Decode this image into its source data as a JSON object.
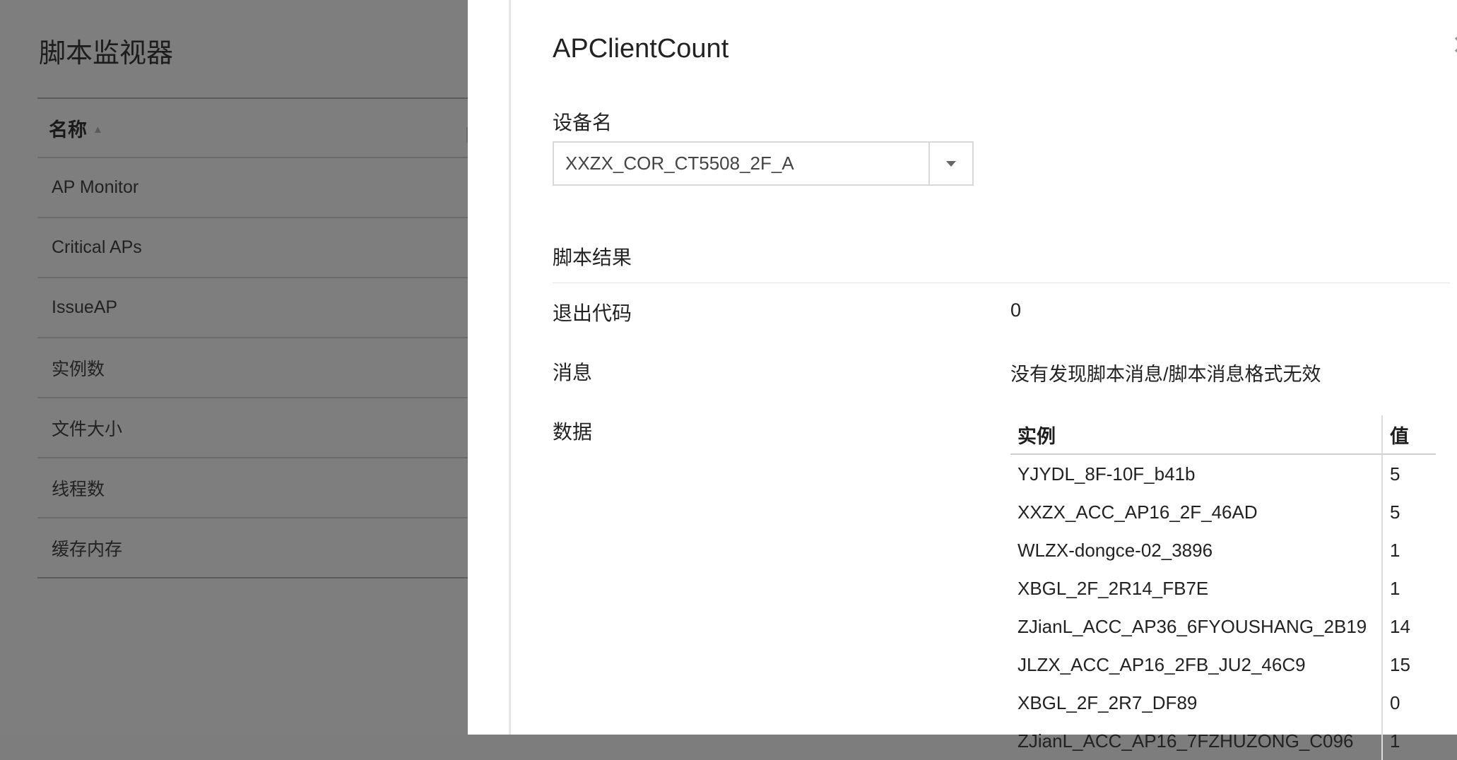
{
  "left": {
    "title": "脚本监视器",
    "column_header": "名称",
    "sort_icon": "▲",
    "rows": [
      "AP Monitor",
      "Critical APs",
      "IssueAP",
      "实例数",
      "文件大小",
      "线程数",
      "缓存内存"
    ]
  },
  "panel": {
    "title": "APClientCount",
    "close_icon": "✕",
    "device_label": "设备名",
    "device_value": "XXZX_COR_CT5508_2F_A",
    "result_section": "脚本结果",
    "exit_code_label": "退出代码",
    "exit_code_value": "0",
    "message_label": "消息",
    "message_value": "没有发现脚本消息/脚本消息格式无效",
    "data_label": "数据",
    "table": {
      "headers": [
        "实例",
        "值"
      ],
      "rows": [
        [
          "YJYDL_8F-10F_b41b",
          "5"
        ],
        [
          "XXZX_ACC_AP16_2F_46AD",
          "5"
        ],
        [
          "WLZX-dongce-02_3896",
          "1"
        ],
        [
          "XBGL_2F_2R14_FB7E",
          "1"
        ],
        [
          "ZJianL_ACC_AP36_6FYOUSHANG_2B19",
          "14"
        ],
        [
          "JLZX_ACC_AP16_2FB_JU2_46C9",
          "15"
        ],
        [
          "XBGL_2F_2R7_DF89",
          "0"
        ],
        [
          "ZJianL_ACC_AP16_7FZHUZONG_C096",
          "1"
        ]
      ]
    }
  }
}
